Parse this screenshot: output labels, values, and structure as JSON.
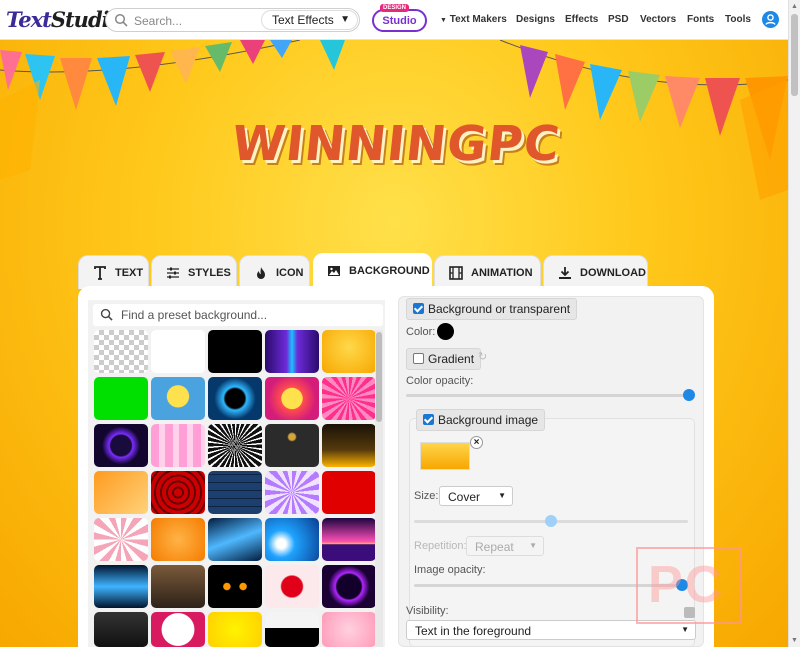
{
  "header": {
    "logo_part1": "Text",
    "logo_part2": "Studio",
    "search_placeholder": "Search...",
    "search_category": "Text Effects",
    "studio_tag": "DESIGN",
    "studio_label": "Studio",
    "nav": [
      "Text Makers",
      "Designs",
      "Effects",
      "PSD",
      "Vectors",
      "Fonts",
      "Tools"
    ],
    "nav_caret_item": "Text Makers"
  },
  "preview": {
    "text": "WINNINGPC"
  },
  "tabs": [
    {
      "label": "TEXT",
      "icon": "text-icon",
      "active": false
    },
    {
      "label": "STYLES",
      "icon": "sliders-icon",
      "active": false
    },
    {
      "label": "ICON",
      "icon": "flame-icon",
      "active": false
    },
    {
      "label": "BACKGROUND",
      "icon": "image-icon",
      "active": true
    },
    {
      "label": "ANIMATION",
      "icon": "film-icon",
      "active": false
    },
    {
      "label": "DOWNLOAD",
      "icon": "download-icon",
      "active": false
    }
  ],
  "background_panel": {
    "find_placeholder": "Find a preset background...",
    "presets": [
      "transparent",
      "white",
      "black",
      "purple-audio-wave",
      "yellow-gradient",
      "green",
      "sponge-cartoon",
      "blue-electric-ring",
      "comic-burst",
      "pink-rays",
      "purple-neon-diamond",
      "pink-flames",
      "black-white-burst",
      "black-crown",
      "stage-lights",
      "anime-character",
      "red-spiderweb",
      "blue-brick-wall",
      "purple-swirl",
      "red",
      "pink-candy-swirl",
      "orange-gradient",
      "blue-light-flare",
      "blue-wave-swirl",
      "synthwave-sunset",
      "blue-light-beam",
      "footballer-portrait",
      "cat-eyes-dark",
      "red-paint-splash",
      "purple-portal",
      "dark-textured",
      "white-cloud-frame",
      "yellow-burst",
      "black-silhouette",
      "pink-blur"
    ]
  },
  "settings": {
    "bg_or_transparent": "Background or transparent",
    "color_label": "Color:",
    "color_value": "#000000",
    "gradient_label": "Gradient",
    "color_opacity_label": "Color opacity:",
    "color_opacity": 1.0,
    "bg_image_label": "Background image",
    "size_label": "Size:",
    "size_value": "Cover",
    "size_slider": 0.5,
    "repetition_label": "Repetition:",
    "repetition_value": "Repeat",
    "image_opacity_label": "Image opacity:",
    "image_opacity": 1.0,
    "visibility_label": "Visibility:",
    "visibility_value": "Text in the foreground"
  },
  "watermark": {
    "text": "PC"
  },
  "colors": {
    "accent": "#1e88e5",
    "studio_purple": "#7a2fd1",
    "preview_text": "#e0572b",
    "hero_bg": "#ffc20e"
  }
}
